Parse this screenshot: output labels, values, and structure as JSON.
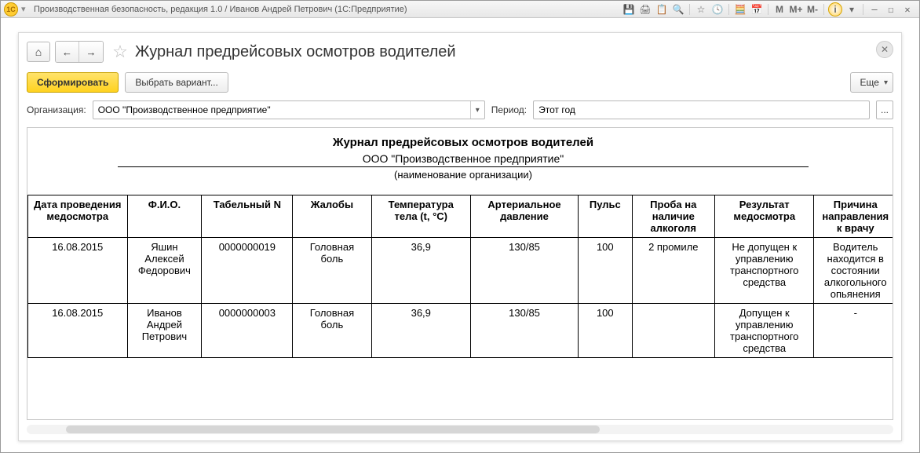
{
  "window": {
    "title": "Производственная безопасность, редакция 1.0 / Иванов Андрей Петрович  (1С:Предприятие)",
    "logo_text": "1C"
  },
  "tb_icons": {
    "save": "💾",
    "print": "🖨",
    "copy": "📋",
    "search": "🔍",
    "star": "☆",
    "history": "🕓",
    "calc": "🧮",
    "cal": "📅",
    "m": "M",
    "mplus": "M+",
    "mminus": "M-",
    "info": "i",
    "min": "—",
    "max": "☐",
    "close": "✕",
    "down": "▾"
  },
  "nav": {
    "home": "⌂",
    "back": "←",
    "fwd": "→",
    "star": "☆"
  },
  "page": {
    "title": "Журнал предрейсовых осмотров водителей",
    "close": "✕"
  },
  "toolbar": {
    "generate": "Сформировать",
    "variant": "Выбрать вариант...",
    "more": "Еще",
    "caret": "▾"
  },
  "filters": {
    "org_label": "Организация:",
    "org_value": "ООО \"Производственное предприятие\"",
    "period_label": "Период:",
    "period_value": "Этот год",
    "ellipsis": "...",
    "caret": "▾"
  },
  "report": {
    "title": "Журнал предрейсовых осмотров водителей",
    "org": "ООО \"Производственное предприятие\"",
    "note": "(наименование организации)",
    "columns": [
      "Дата проведения медосмотра",
      "Ф.И.О.",
      "Табельный N",
      "Жалобы",
      "Температура тела (t, °C)",
      "Артериальное давление",
      "Пульс",
      "Проба на наличие алкоголя",
      "Результат медосмотра",
      "Причина направления к врачу"
    ],
    "rows": [
      {
        "date": "16.08.2015",
        "fio": "Яшин Алексей Федорович",
        "tabn": "0000000019",
        "complaints": "Головная боль",
        "temp": "36,9",
        "bp": "130/85",
        "pulse": "100",
        "alcohol": "2 промиле",
        "result": "Не допущен к управлению транспортного средства",
        "reason": "Водитель находится в состоянии алкогольного опьянения"
      },
      {
        "date": "16.08.2015",
        "fio": "Иванов Андрей Петрович",
        "tabn": "0000000003",
        "complaints": "Головная боль",
        "temp": "36,9",
        "bp": "130/85",
        "pulse": "100",
        "alcohol": "",
        "result": "Допущен к управлению транспортного средства",
        "reason": "-"
      }
    ]
  }
}
